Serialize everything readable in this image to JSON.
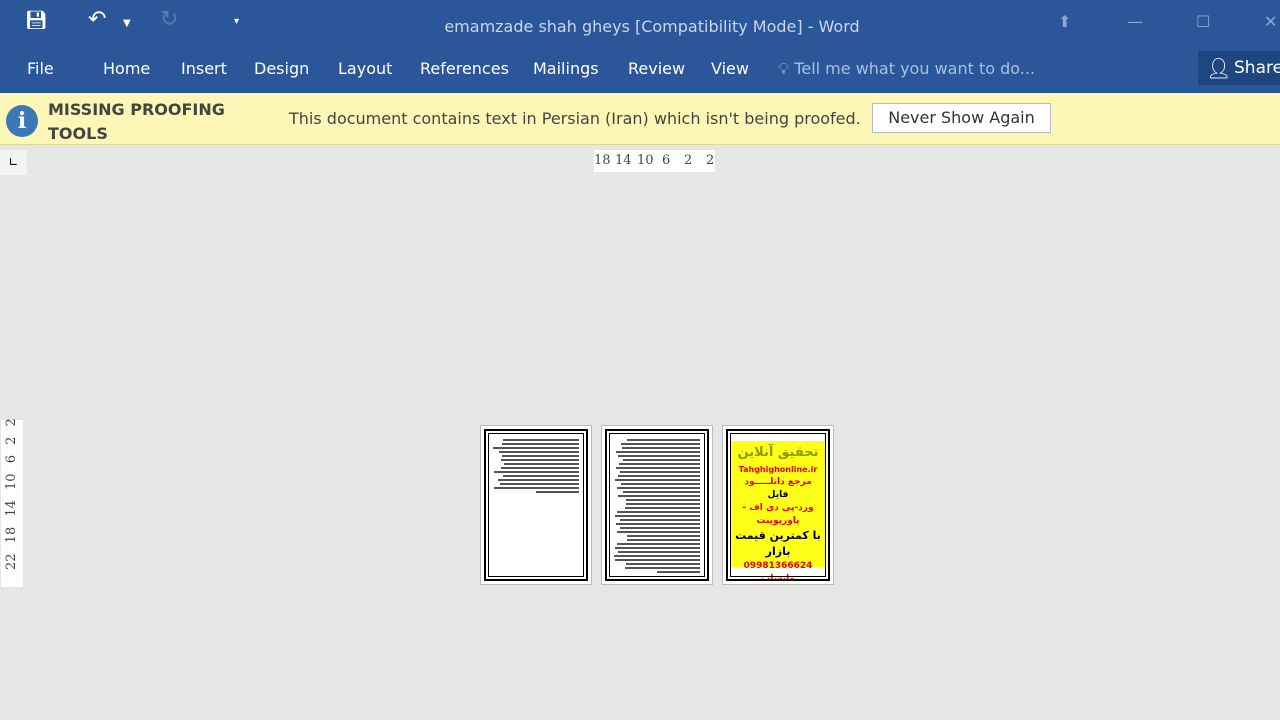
{
  "window": {
    "title": "emamzade shah gheys [Compatibility Mode] - Word"
  },
  "qat": {
    "save": "save-icon",
    "undo": "undo-icon",
    "redo": "redo-icon",
    "customize": "customize-qat-icon"
  },
  "ribbon": {
    "tabs": [
      "File",
      "Home",
      "Insert",
      "Design",
      "Layout",
      "References",
      "Mailings",
      "Review",
      "View"
    ],
    "tell_me": "Tell me what you want to do...",
    "share": "Share"
  },
  "message_bar": {
    "title": "MISSING PROOFING TOOLS",
    "text": "This document contains text in Persian (Iran) which isn't being proofed.",
    "button": "Never Show Again"
  },
  "ruler": {
    "horizontal": [
      "18",
      "14",
      "10",
      "6",
      "2",
      "2"
    ],
    "vertical": "22 18 14 10 6 2 2"
  },
  "pages": [
    {
      "label": "page 1"
    },
    {
      "label": "page 2"
    },
    {
      "ad": {
        "title": "تحقیق آنلاین",
        "site": "Tahghighonline.ir",
        "line1": "مرجع دانلـــــود",
        "line2": "فایل",
        "line3": "ورد-پی دی اف - پاورپوینت",
        "line4": "با کمترین قیمت بازار",
        "phone": "09981366624 واتساپ"
      }
    }
  ],
  "colors": {
    "ribbon": "#2b579a",
    "message_bar": "#fcf7b6",
    "ad_background": "#ffff1a"
  }
}
